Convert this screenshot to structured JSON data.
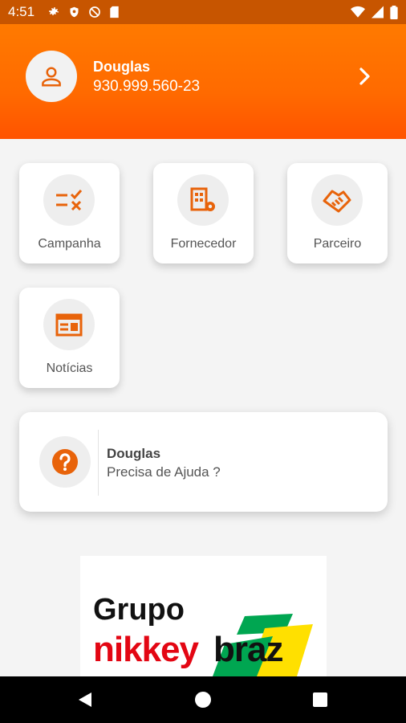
{
  "status_bar": {
    "time": "4:51"
  },
  "header": {
    "name": "Douglas",
    "id_number": "930.999.560-23"
  },
  "tiles": [
    {
      "label": "Campanha",
      "icon": "list-check-icon"
    },
    {
      "label": "Fornecedor",
      "icon": "building-gear-icon"
    },
    {
      "label": "Parceiro",
      "icon": "handshake-icon"
    },
    {
      "label": "Notícias",
      "icon": "newspaper-icon"
    }
  ],
  "help": {
    "name": "Douglas",
    "text": "Precisa de Ajuda ?"
  },
  "logo": {
    "line1": "Grupo",
    "line2a": "nikkey",
    "line2b": "braz"
  },
  "colors": {
    "accent": "#ff6d00",
    "icon": "#e8630a",
    "status_bar": "#c75500"
  }
}
